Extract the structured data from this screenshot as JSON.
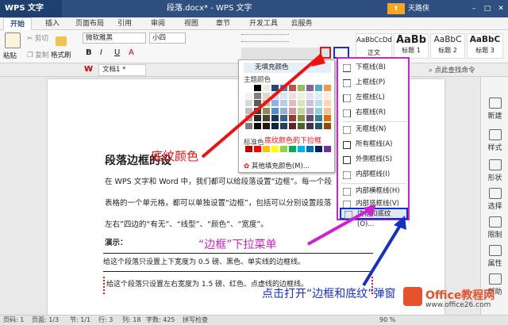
{
  "titlebar": {
    "app": "WPS 文字",
    "doc": "段落.docx* - WPS 文字",
    "user": "天路侠"
  },
  "tabs": [
    "开始",
    "插入",
    "页面布局",
    "引用",
    "审阅",
    "视图",
    "章节",
    "开发工具",
    "云服务"
  ],
  "ribbon": {
    "paste": "粘贴",
    "cut": "剪切",
    "copy": "复制",
    "format_painter": "格式刷",
    "font": "微软雅黑",
    "size": "小四",
    "styles": [
      {
        "preview": "AaBbCcDd",
        "label": "正文"
      },
      {
        "preview": "AaBb",
        "label": "标题 1"
      },
      {
        "preview": "AaBbC",
        "label": "标题 2"
      },
      {
        "preview": "AaBbC",
        "label": "标题 3"
      }
    ]
  },
  "doctabs": {
    "doc": "文档1 *",
    "search_hint": "点此查找命令"
  },
  "shading": {
    "none": "无填充颜色",
    "theme": "主题颜色",
    "standard": "标准色",
    "more": "其他填充颜色(M)..."
  },
  "borders": [
    "下框线(B)",
    "上框线(P)",
    "左框线(L)",
    "右框线(R)",
    "无框线(N)",
    "所有框线(A)",
    "外侧框线(S)",
    "内部框线(I)",
    "内部横框线(H)",
    "内部竖框线(V)",
    "边框和底纹(O)..."
  ],
  "document": {
    "heading": "段落边框的设",
    "p1": "在 WPS 文字和 Word 中，我们都可以给段落设置“边框”。每一个段",
    "p2": "表格的一个单元格，都可以单独设置“边框”，包括可以分别设置段落",
    "p3": "左右”四边的“有无”、“线型”、“颜色”、“宽度”。",
    "demo": "演示：",
    "line1": "给这个段落只设置上下宽度为 0.5 磅、黑色、单实线的边框线。",
    "line2": "给这个段落只设置左右宽度为 1.5 磅、红色、点虚线的边框线。"
  },
  "annotations": {
    "shading_color": "底纹颜色",
    "shading_dropdown": "底纹颜色的下拉框",
    "border_dropdown": "“边框”下拉菜单",
    "open_dialog": "点击打开“边框和底纹”弹窗"
  },
  "rightpanel": [
    "新建",
    "样式",
    "形状",
    "选择",
    "限制",
    "属性",
    "帮助"
  ],
  "status": {
    "page": "页码: 1",
    "pages": "页面: 1/3",
    "section": "节: 1/1",
    "row": "行: 3",
    "col": "列: 18",
    "words": "字数: 425",
    "spell": "拼写检查",
    "zoom": "90 %"
  },
  "watermark": {
    "text": "Office教程网",
    "url": "www.office26.com"
  },
  "colors": {
    "accent": "#2f4f7f",
    "red": "#e11",
    "magenta": "#d020d0",
    "blue": "#1530c8"
  }
}
